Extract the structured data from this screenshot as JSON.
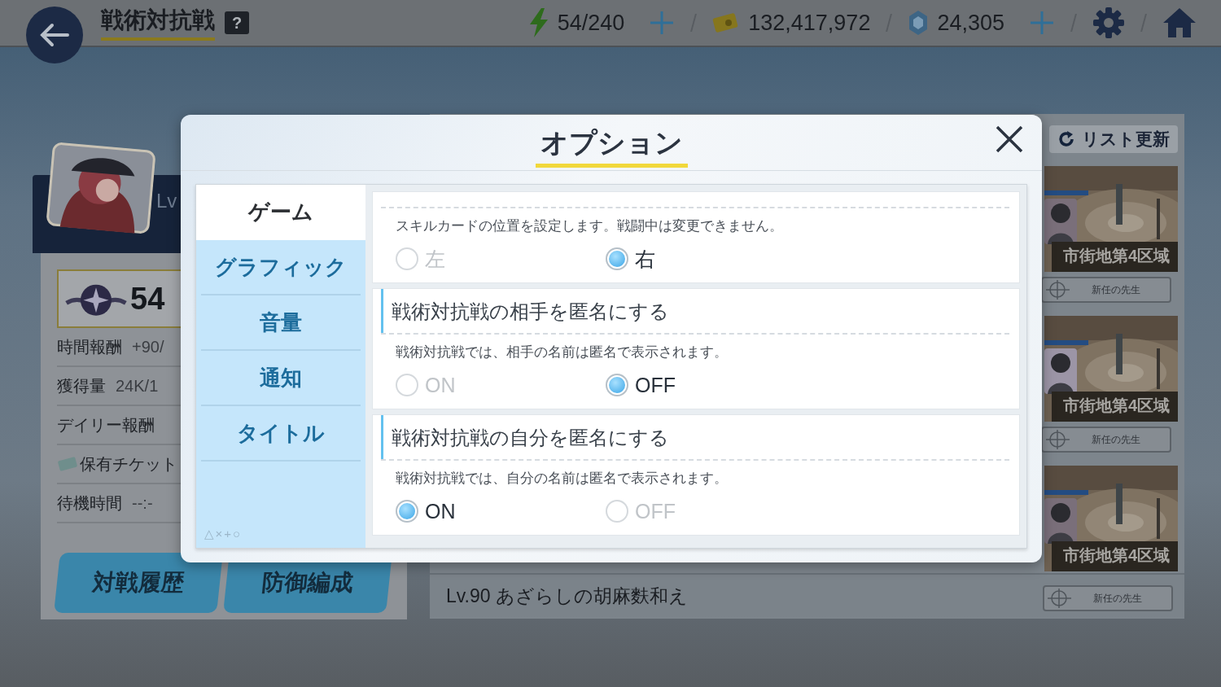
{
  "top_bar": {
    "title": "戦術対抗戦",
    "help": "?",
    "stamina": "54/240",
    "credits": "132,417,972",
    "gems": "24,305"
  },
  "left_panel": {
    "level_label": "Lv",
    "rank": "54",
    "stats": [
      {
        "kind": "plain",
        "label": "時間報酬",
        "value": "+90/"
      },
      {
        "kind": "plain",
        "label": "獲得量",
        "value": "24K/1"
      },
      {
        "kind": "plain",
        "label": "デイリー報酬"
      },
      {
        "kind": "ticket",
        "label": "保有チケット"
      },
      {
        "kind": "plain",
        "label": "待機時間",
        "value": "--:-"
      }
    ],
    "buttons": [
      "対戦履歴",
      "防御編成"
    ]
  },
  "right_panel": {
    "refresh": "リスト更新",
    "opponents": [
      {
        "area": "市街地第4区域",
        "name": "新任の先生"
      },
      {
        "area": "市街地第4区域",
        "name": "新任の先生"
      },
      {
        "area": "市街地第4区域"
      }
    ],
    "bottom_row": {
      "title": "Lv.90 あざらしの胡麻麩和え",
      "name": "新任の先生"
    }
  },
  "dialog": {
    "title": "オプション",
    "tabs": [
      {
        "label": "ゲーム",
        "selected": true
      },
      {
        "label": "グラフィック",
        "selected": false
      },
      {
        "label": "音量",
        "selected": false
      },
      {
        "label": "通知",
        "selected": false
      },
      {
        "label": "タイトル",
        "selected": false
      }
    ],
    "footer_mark": "△×+○",
    "sections": [
      {
        "description": "スキルカードの位置を設定します。戦闘中は変更できません。",
        "options": [
          {
            "label": "左",
            "selected": false
          },
          {
            "label": "右",
            "selected": true
          }
        ]
      },
      {
        "heading": "戦術対抗戦の相手を匿名にする",
        "description": "戦術対抗戦では、相手の名前は匿名で表示されます。",
        "options": [
          {
            "label": "ON",
            "selected": false
          },
          {
            "label": "OFF",
            "selected": true
          }
        ]
      },
      {
        "heading": "戦術対抗戦の自分を匿名にする",
        "description": "戦術対抗戦では、自分の名前は匿名で表示されます。",
        "options": [
          {
            "label": "ON",
            "selected": true
          },
          {
            "label": "OFF",
            "selected": false
          }
        ]
      }
    ]
  }
}
